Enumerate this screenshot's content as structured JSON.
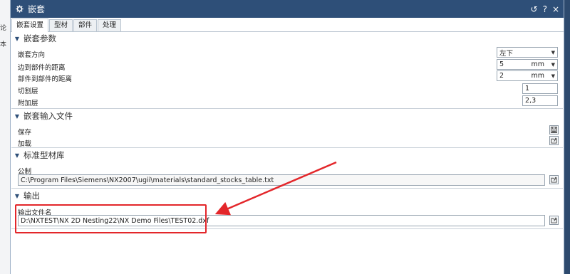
{
  "background": {
    "left_fragments": [
      "论",
      "本"
    ]
  },
  "window": {
    "title": "嵌套",
    "controls": {
      "reset": "↺",
      "help": "?",
      "close": "×"
    }
  },
  "tabs": [
    {
      "label": "嵌套设置",
      "active": true
    },
    {
      "label": "型材",
      "active": false
    },
    {
      "label": "部件",
      "active": false
    },
    {
      "label": "处理",
      "active": false
    }
  ],
  "nesting_params": {
    "title": "嵌套参数",
    "direction_label": "嵌套方向",
    "direction_value": "左下",
    "edge_distance_label": "边到部件的距离",
    "edge_distance_value": "5",
    "edge_distance_unit": "mm",
    "part_distance_label": "部件到部件的距离",
    "part_distance_value": "2",
    "part_distance_unit": "mm",
    "cut_layer_label": "切割层",
    "cut_layer_value": "1",
    "extra_layer_label": "附加层",
    "extra_layer_value": "2,3"
  },
  "input_file": {
    "title": "嵌套输入文件",
    "save_label": "保存",
    "load_label": "加载"
  },
  "std_stock": {
    "title": "标准型材库",
    "metric_label": "公制",
    "path": "C:\\Program Files\\Siemens\\NX2007\\ugii\\materials\\standard_stocks_table.txt"
  },
  "output": {
    "title": "输出",
    "file_label": "输出文件名",
    "path": "D:\\NXTEST\\NX 2D Nesting22\\NX Demo Files\\TEST02.dxf"
  },
  "colors": {
    "titlebar": "#2e4f78",
    "annotation": "#e3262a"
  },
  "icons": [
    "gear-icon",
    "reset-icon",
    "help-icon",
    "close-icon",
    "collapse-chevron-icon",
    "dropdown-arrow-icon",
    "save-file-icon",
    "open-file-icon"
  ]
}
